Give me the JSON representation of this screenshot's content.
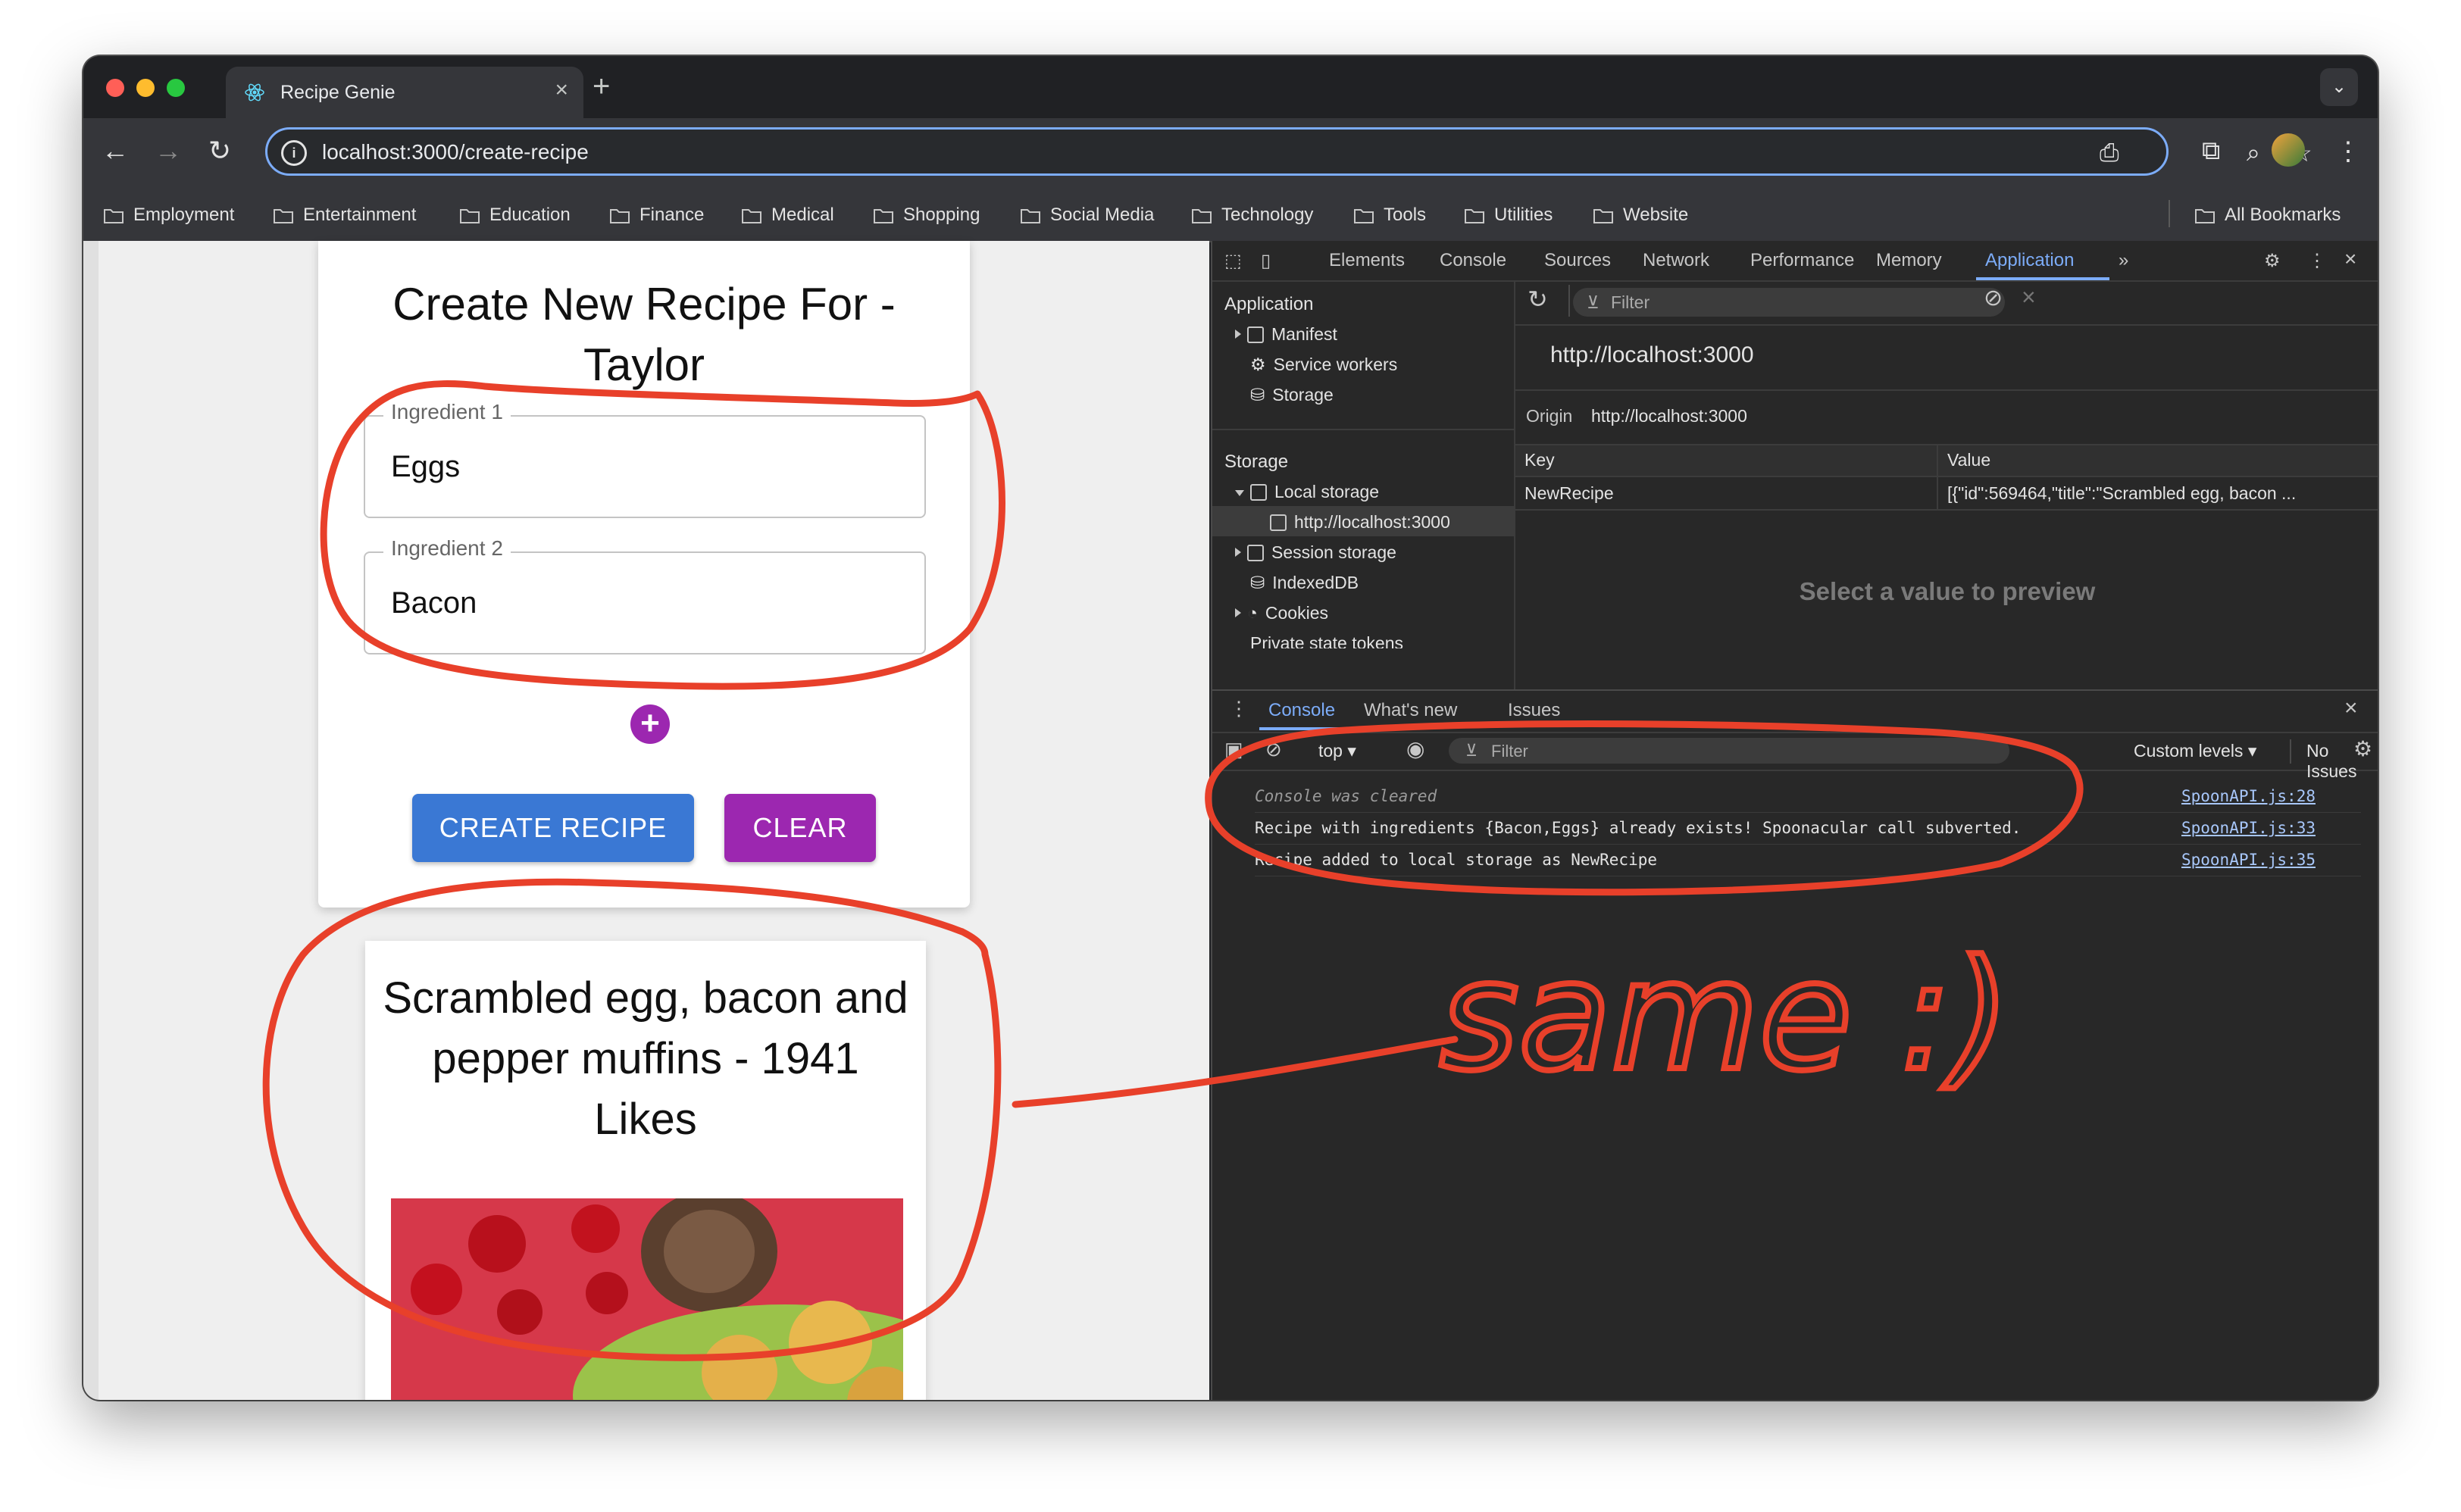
{
  "browser": {
    "tab_title": "Recipe Genie",
    "url": "localhost:3000/create-recipe",
    "bookmarks": [
      "Employment",
      "Entertainment",
      "Education",
      "Finance",
      "Medical",
      "Shopping",
      "Social Media",
      "Technology",
      "Tools",
      "Utilities",
      "Website"
    ],
    "all_bookmarks": "All Bookmarks"
  },
  "page": {
    "form_title": "Create New Recipe For - Taylor",
    "ingredients": [
      {
        "label": "Ingredient 1",
        "value": "Eggs"
      },
      {
        "label": "Ingredient 2",
        "value": "Bacon"
      }
    ],
    "create_button": "CREATE RECIPE",
    "clear_button": "CLEAR",
    "result_title": "Scrambled egg, bacon and pepper muffins - 1941 Likes"
  },
  "devtools": {
    "tabs": [
      "Elements",
      "Console",
      "Sources",
      "Network",
      "Performance",
      "Memory",
      "Application"
    ],
    "active_tab": "Application",
    "application_header": "Application",
    "application_items": [
      "Manifest",
      "Service workers",
      "Storage"
    ],
    "storage_header": "Storage",
    "storage_items": {
      "local_storage": "Local storage",
      "local_storage_origin": "http://localhost:3000",
      "session_storage": "Session storage",
      "indexeddb": "IndexedDB",
      "cookies": "Cookies",
      "private_state": "Private state tokens"
    },
    "filter_placeholder": "Filter",
    "origin_heading": "http://localhost:3000",
    "origin_label": "Origin",
    "origin_value": "http://localhost:3000",
    "table_headers": {
      "key": "Key",
      "value": "Value"
    },
    "table_rows": [
      {
        "key": "NewRecipe",
        "value": "[{\"id\":569464,\"title\":\"Scrambled egg, bacon ..."
      }
    ],
    "preview_text": "Select a value to preview",
    "drawer_tabs": [
      "Console",
      "What's new",
      "Issues"
    ],
    "console_context": "top",
    "console_filter": "Filter",
    "custom_levels": "Custom levels",
    "no_issues": "No Issues",
    "console_lines": [
      {
        "text": "Console was cleared",
        "source": "SpoonAPI.js:28",
        "italic": true
      },
      {
        "text": "Recipe with ingredients {Bacon,Eggs} already exists! Spoonacular call subverted.",
        "source": "SpoonAPI.js:33",
        "italic": false
      },
      {
        "text": "Recipe added to local storage as NewRecipe",
        "source": "SpoonAPI.js:35",
        "italic": false
      }
    ]
  },
  "annotation": {
    "handwriting": "same :)",
    "color": "#e8402a"
  }
}
